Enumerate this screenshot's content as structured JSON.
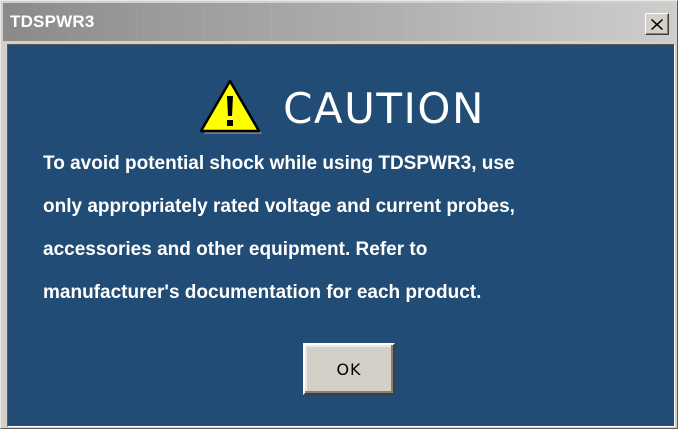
{
  "window": {
    "title": "TDSPWR3",
    "close_symbol": "✕"
  },
  "dialog": {
    "heading": "CAUTION",
    "icon": "warning-triangle-icon",
    "message_lines": [
      "To avoid potential shock while using TDSPWR3, use",
      "only appropriately rated voltage and current probes,",
      "accessories and other equipment. Refer to",
      "manufacturer's documentation for each product."
    ],
    "ok_label": "OK"
  },
  "colors": {
    "client_background": "#214c75",
    "text": "#ffffff",
    "warning_yellow": "#ffff00",
    "button_face": "#d4d0c8"
  }
}
